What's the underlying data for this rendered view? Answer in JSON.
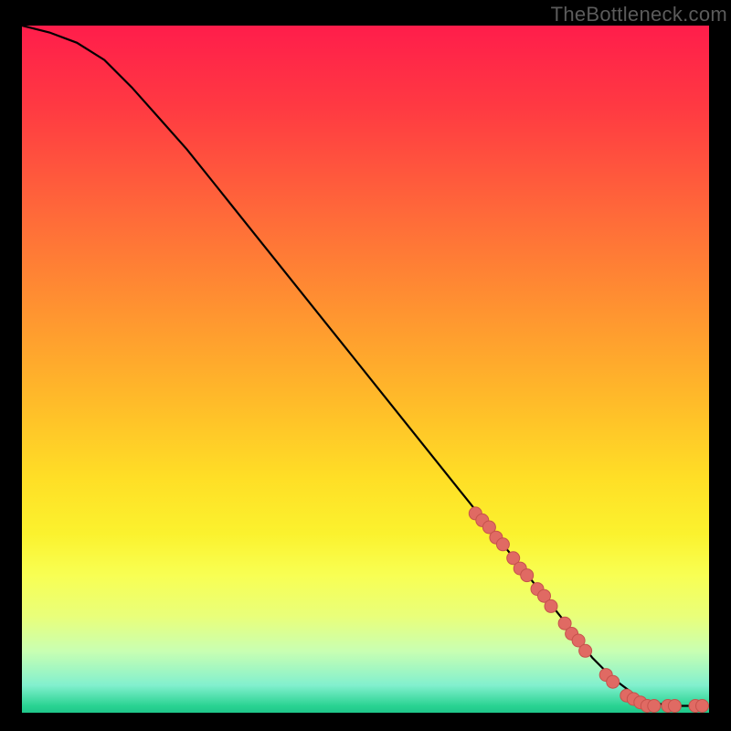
{
  "watermark": "TheBottleneck.com",
  "colors": {
    "line": "#000000",
    "dot_fill": "#e06a63",
    "dot_stroke": "#c6524c"
  },
  "chart_data": {
    "type": "line",
    "title": "",
    "xlabel": "",
    "ylabel": "",
    "xlim": [
      0,
      100
    ],
    "ylim": [
      0,
      100
    ],
    "series": [
      {
        "name": "curve",
        "x": [
          0,
          4,
          8,
          12,
          16,
          20,
          24,
          28,
          32,
          36,
          40,
          44,
          48,
          52,
          56,
          60,
          64,
          68,
          72,
          76,
          80,
          83,
          86,
          90,
          94,
          98,
          100
        ],
        "y": [
          100,
          99,
          97.5,
          95,
          91,
          86.5,
          82,
          77,
          72,
          67,
          62,
          57,
          52,
          47,
          42,
          37,
          32,
          27,
          22,
          17,
          12,
          8,
          5,
          2,
          1,
          1,
          1
        ]
      }
    ],
    "points": [
      {
        "x": 66,
        "y": 29
      },
      {
        "x": 67,
        "y": 28
      },
      {
        "x": 68,
        "y": 27
      },
      {
        "x": 69,
        "y": 25.5
      },
      {
        "x": 70,
        "y": 24.5
      },
      {
        "x": 71.5,
        "y": 22.5
      },
      {
        "x": 72.5,
        "y": 21
      },
      {
        "x": 73.5,
        "y": 20
      },
      {
        "x": 75,
        "y": 18
      },
      {
        "x": 76,
        "y": 17
      },
      {
        "x": 77,
        "y": 15.5
      },
      {
        "x": 79,
        "y": 13
      },
      {
        "x": 80,
        "y": 11.5
      },
      {
        "x": 81,
        "y": 10.5
      },
      {
        "x": 82,
        "y": 9
      },
      {
        "x": 85,
        "y": 5.5
      },
      {
        "x": 86,
        "y": 4.5
      },
      {
        "x": 88,
        "y": 2.5
      },
      {
        "x": 89,
        "y": 2
      },
      {
        "x": 90,
        "y": 1.5
      },
      {
        "x": 91,
        "y": 1
      },
      {
        "x": 92,
        "y": 1
      },
      {
        "x": 94,
        "y": 1
      },
      {
        "x": 95,
        "y": 1
      },
      {
        "x": 98,
        "y": 1
      },
      {
        "x": 99,
        "y": 1
      }
    ]
  }
}
